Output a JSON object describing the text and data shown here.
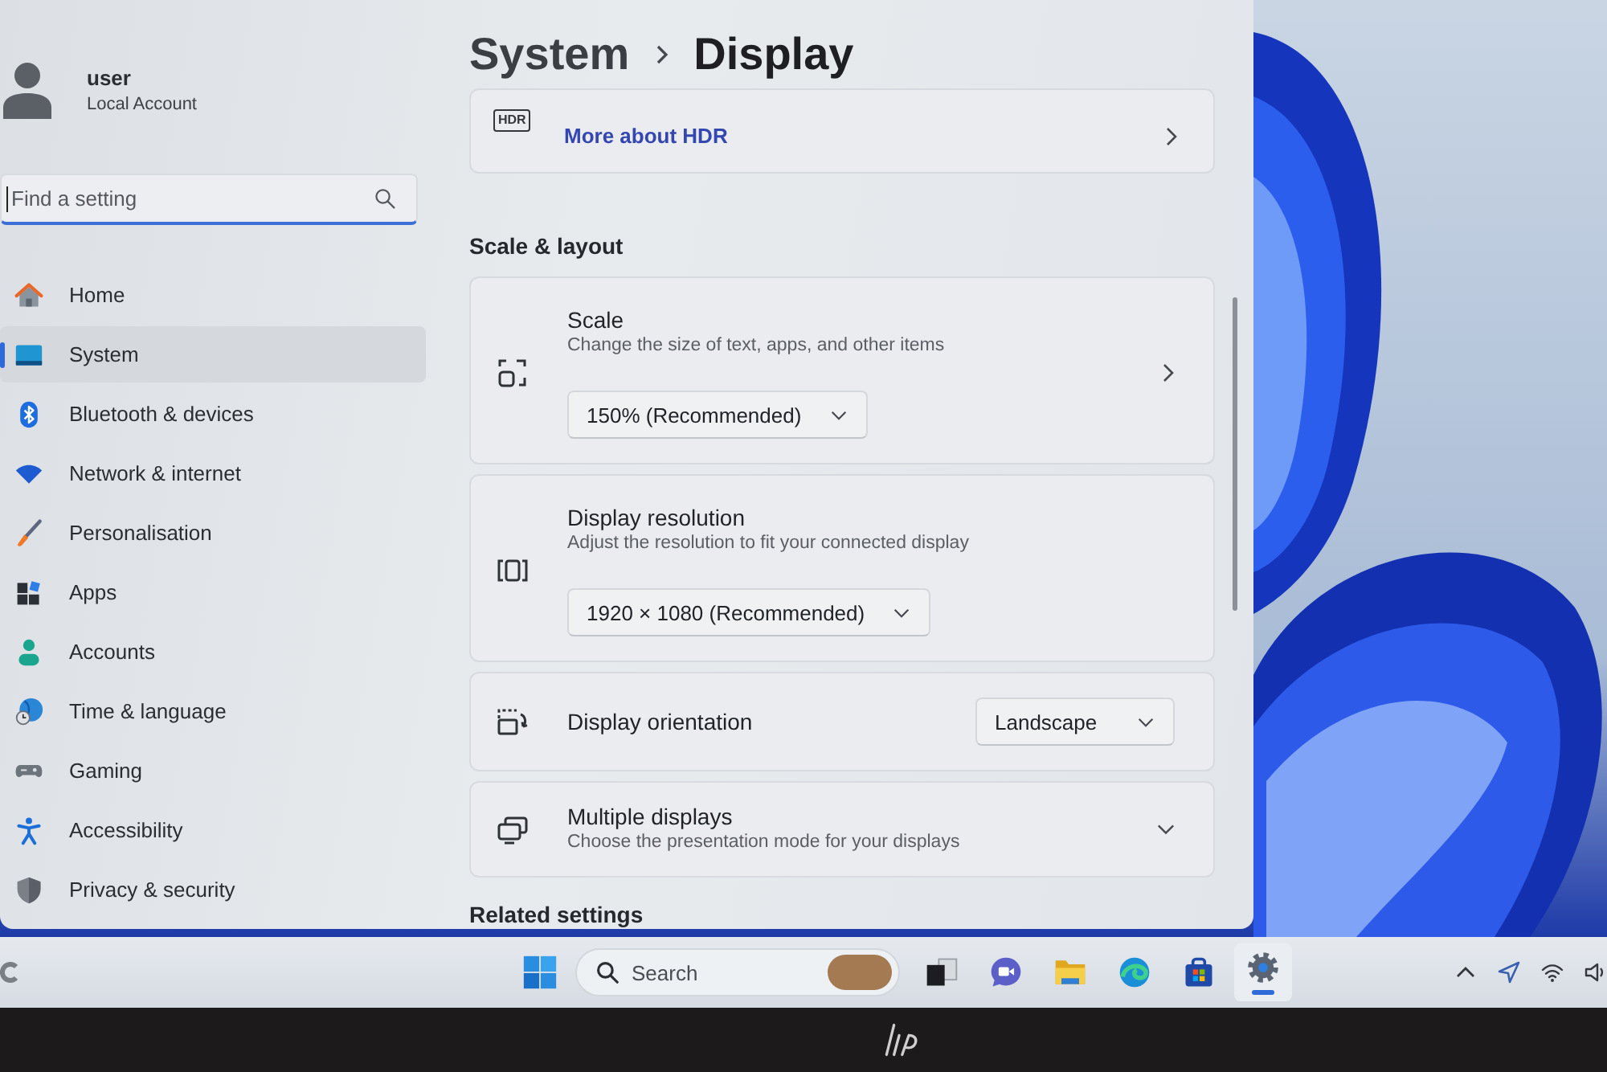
{
  "sidebar": {
    "user": {
      "name": "user",
      "account": "Local Account"
    },
    "search": {
      "placeholder": "Find a setting",
      "focused": true
    },
    "items": [
      {
        "label": "Home",
        "selected": false
      },
      {
        "label": "System",
        "selected": true
      },
      {
        "label": "Bluetooth & devices",
        "selected": false
      },
      {
        "label": "Network & internet",
        "selected": false
      },
      {
        "label": "Personalisation",
        "selected": false
      },
      {
        "label": "Apps",
        "selected": false
      },
      {
        "label": "Accounts",
        "selected": false
      },
      {
        "label": "Time & language",
        "selected": false
      },
      {
        "label": "Gaming",
        "selected": false
      },
      {
        "label": "Accessibility",
        "selected": false
      },
      {
        "label": "Privacy & security",
        "selected": false
      }
    ]
  },
  "header": {
    "breadcrumb": [
      "System",
      "Display"
    ]
  },
  "hdr_card": {
    "icon_label": "HDR",
    "link": "More about HDR"
  },
  "section": {
    "heading": "Scale & layout",
    "settings": [
      {
        "kind": "navigate",
        "title": "Scale",
        "description": "Change the size of text, apps, and other items",
        "value": "150% (Recommended)"
      },
      {
        "kind": "select",
        "title": "Display resolution",
        "description": "Adjust the resolution to fit your connected display",
        "value": "1920 × 1080 (Recommended)"
      },
      {
        "kind": "inline",
        "title": "Display orientation",
        "value": "Landscape"
      },
      {
        "kind": "expander",
        "title": "Multiple displays",
        "description": "Choose the presentation mode for your displays",
        "expanded": false
      }
    ]
  },
  "related_heading": "Related settings",
  "taskbar": {
    "search": {
      "placeholder": "Search"
    },
    "apps": [
      {
        "open": false
      },
      {
        "open": false
      },
      {
        "open": false
      },
      {
        "open": false
      },
      {
        "open": false
      },
      {
        "open": true
      }
    ]
  }
}
